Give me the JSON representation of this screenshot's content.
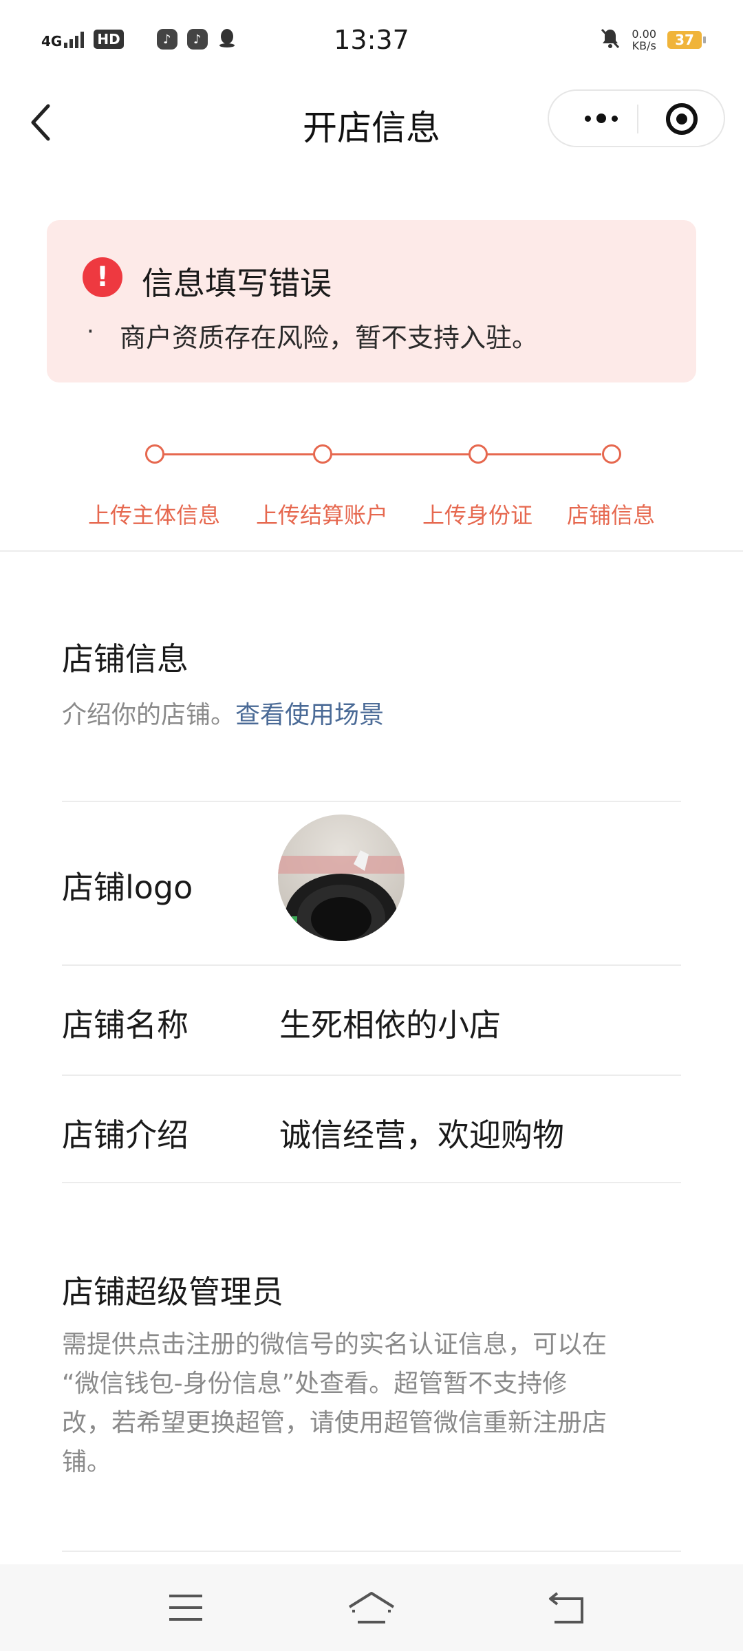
{
  "status_bar": {
    "time": "13:37",
    "network": "4G",
    "hd": "HD",
    "speed_value": "0.00",
    "speed_unit": "KB/s",
    "battery": "37",
    "icons": [
      "signal-icon",
      "hd-icon",
      "app-notification-icon",
      "app-notification-icon",
      "qq-icon",
      "mute-icon",
      "battery-icon"
    ]
  },
  "nav": {
    "title": "开店信息"
  },
  "error": {
    "title": "信息填写错误",
    "bullet": "·",
    "message": "商户资质存在风险，暂不支持入驻。",
    "color": "#ee3940"
  },
  "steps": [
    {
      "label": "上传主体信息"
    },
    {
      "label": "上传结算账户"
    },
    {
      "label": "上传身份证"
    },
    {
      "label": "店铺信息"
    }
  ],
  "shop_info": {
    "title": "店铺信息",
    "subtitle": "介绍你的店铺。",
    "link": "查看使用场景",
    "logo_label": "店铺logo",
    "name_label": "店铺名称",
    "name_value": "生死相依的小店",
    "intro_label": "店铺介绍",
    "intro_value": "诚信经营，欢迎购物"
  },
  "admin": {
    "title": "店铺超级管理员",
    "desc_lines": [
      "需提供点击注册的微信号的实名认证信息，可以在",
      "“微信钱包-身份信息”处查看。超管暂不支持修",
      "改，若希望更换超管，请使用超管微信重新注册店",
      "铺。"
    ]
  },
  "colors": {
    "accent": "#e6684f",
    "link": "#4a6a96",
    "error_bg": "#fdeae8"
  }
}
